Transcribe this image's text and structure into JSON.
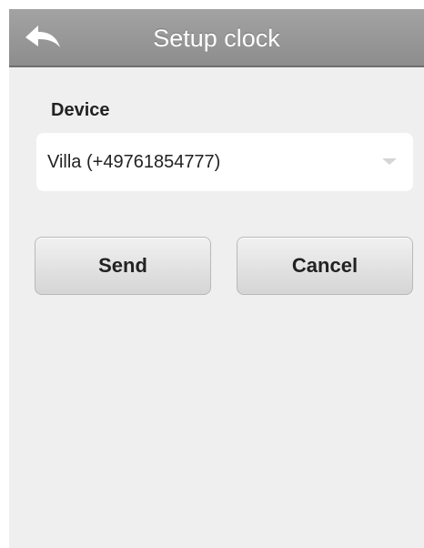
{
  "header": {
    "title": "Setup clock",
    "back_icon": "back-arrow-icon"
  },
  "device": {
    "label": "Device",
    "selected": "Villa (+49761854777)"
  },
  "actions": {
    "send_label": "Send",
    "cancel_label": "Cancel"
  },
  "colors": {
    "header_bg": "#999999",
    "body_bg": "#efefef",
    "button_text": "#222222"
  }
}
